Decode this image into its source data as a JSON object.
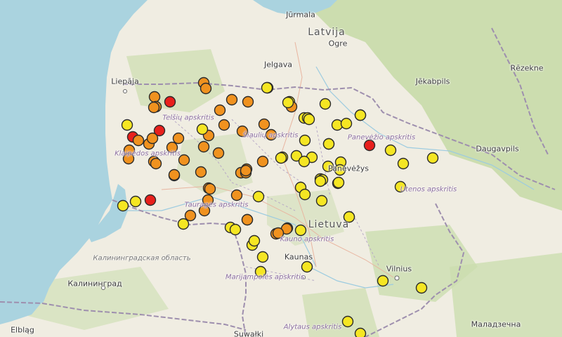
{
  "labels": {
    "jurmala": "Jūrmala",
    "latvija": "Latvija",
    "ogre": "Ogre",
    "jelgava": "Jelgava",
    "liepaja": "Liepāja",
    "jekabpils": "Jēkabpils",
    "rezekne": "Rēzekne",
    "daugavpils": "Daugavpils",
    "telsiu": "Telšių apskritis",
    "siauliu": "Šiaulių apskritis",
    "panevezio": "Panevėžio apskritis",
    "klaipedos": "Klaipėdos apskritis",
    "taurages": "Tauragės apskritis",
    "utenos": "Utenos apskritis",
    "lietuva": "Lietuva",
    "kauno": "Kauno apskritis",
    "kaunas": "Kaunas",
    "marijampoles": "Marijampolės apskritis",
    "vilnius": "Vilnius",
    "alytaus": "Alytaus apskritis",
    "kaliningrad_obl": "Калининградская область",
    "kaliningrad": "Калининград",
    "elblag": "Elbląg",
    "suwalki": "Suwałki",
    "maladzechna": "Маладзечна",
    "panevezys": "Panevėžys"
  },
  "colors": {
    "sea": "#aad3df",
    "land": "#f0ede2",
    "forest": "#c8dcaa",
    "border": "#9e8fae",
    "level_low": "#f5e623",
    "level_mid": "#f0921f",
    "level_high": "#e8201c",
    "marker_stroke": "#2b2b2b"
  },
  "legend_levels": [
    "low",
    "mid",
    "high"
  ],
  "markers": [
    {
      "level": "mid"
    },
    {
      "level": "mid"
    },
    {
      "level": "mid"
    },
    {
      "level": "mid"
    },
    {
      "level": "high"
    },
    {
      "level": "mid"
    },
    {
      "level": "mid"
    },
    {
      "level": "mid"
    },
    {
      "level": "mid"
    },
    {
      "level": "mid"
    },
    {
      "level": "low"
    },
    {
      "level": "mid"
    },
    {
      "level": "high"
    },
    {
      "level": "low"
    },
    {
      "level": "high"
    },
    {
      "level": "mid"
    },
    {
      "level": "mid"
    },
    {
      "level": "mid"
    },
    {
      "level": "mid"
    },
    {
      "level": "mid"
    },
    {
      "level": "mid"
    },
    {
      "level": "mid"
    },
    {
      "level": "mid"
    },
    {
      "level": "mid"
    },
    {
      "level": "mid"
    },
    {
      "level": "mid"
    },
    {
      "level": "mid"
    },
    {
      "level": "low"
    },
    {
      "level": "mid"
    },
    {
      "level": "mid"
    },
    {
      "level": "mid"
    },
    {
      "level": "mid"
    },
    {
      "level": "mid"
    },
    {
      "level": "mid"
    },
    {
      "level": "mid"
    },
    {
      "level": "mid"
    },
    {
      "level": "mid"
    },
    {
      "level": "mid"
    },
    {
      "level": "mid"
    },
    {
      "level": "mid"
    },
    {
      "level": "mid"
    },
    {
      "level": "low"
    },
    {
      "level": "low"
    },
    {
      "level": "high"
    },
    {
      "level": "mid"
    },
    {
      "level": "mid"
    },
    {
      "level": "mid"
    },
    {
      "level": "mid"
    },
    {
      "level": "mid"
    },
    {
      "level": "mid"
    },
    {
      "level": "mid"
    },
    {
      "level": "low"
    },
    {
      "level": "low"
    },
    {
      "level": "low"
    },
    {
      "level": "low"
    },
    {
      "level": "low"
    },
    {
      "level": "low"
    },
    {
      "level": "low"
    },
    {
      "level": "low"
    },
    {
      "level": "mid"
    },
    {
      "level": "mid"
    },
    {
      "level": "mid"
    },
    {
      "level": "mid"
    },
    {
      "level": "low"
    },
    {
      "level": "low"
    },
    {
      "level": "low"
    },
    {
      "level": "low"
    },
    {
      "level": "low"
    },
    {
      "level": "low"
    },
    {
      "level": "low"
    },
    {
      "level": "low"
    },
    {
      "level": "low"
    },
    {
      "level": "mid"
    },
    {
      "level": "low"
    },
    {
      "level": "low"
    },
    {
      "level": "low"
    },
    {
      "level": "low"
    },
    {
      "level": "low"
    },
    {
      "level": "low"
    },
    {
      "level": "low"
    },
    {
      "level": "low"
    },
    {
      "level": "low"
    },
    {
      "level": "low"
    },
    {
      "level": "low"
    },
    {
      "level": "low"
    },
    {
      "level": "low"
    },
    {
      "level": "high"
    },
    {
      "level": "high"
    },
    {
      "level": "low"
    },
    {
      "level": "low"
    },
    {
      "level": "low"
    },
    {
      "level": "low"
    },
    {
      "level": "low"
    },
    {
      "level": "low"
    },
    {
      "level": "low"
    },
    {
      "level": "low"
    },
    {
      "level": "low"
    },
    {
      "level": "low"
    },
    {
      "level": "low"
    },
    {
      "level": "low"
    },
    {
      "level": "low"
    },
    {
      "level": "low"
    },
    {
      "level": "low"
    },
    {
      "level": "low"
    },
    {
      "level": "low"
    },
    {
      "level": "low"
    },
    {
      "level": "low"
    }
  ]
}
